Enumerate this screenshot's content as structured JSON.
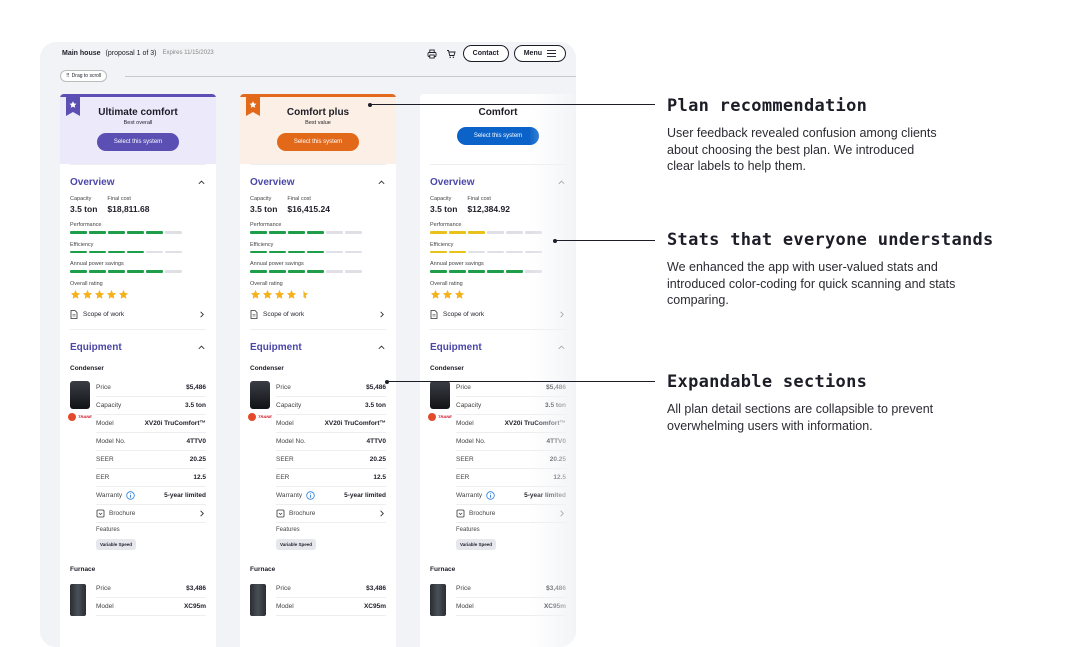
{
  "app": {
    "title": "Main house",
    "subtitle": "(proposal 1 of 3)",
    "expires": "Expires 11/15/2023",
    "contact_label": "Contact",
    "menu_label": "Menu",
    "drag_label": "Drag to scroll"
  },
  "labels": {
    "overview": "Overview",
    "capacity": "Capacity",
    "final_cost": "Final cost",
    "performance": "Performance",
    "efficiency": "Efficiency",
    "annual_savings": "Annual power savings",
    "overall_rating": "Overall rating",
    "scope_of_work": "Scope of work",
    "equipment": "Equipment",
    "condenser": "Condenser",
    "furnace": "Furnace",
    "price": "Price",
    "model": "Model",
    "model_no": "Model No.",
    "seer": "SEER",
    "eer": "EER",
    "warranty": "Warranty",
    "brochure": "Brochure",
    "features": "Features",
    "brand": "TRANE"
  },
  "plans": [
    {
      "name": "Ultimate comfort",
      "tag": "Best overall",
      "select_label": "Select this system",
      "accent": "#5b4fb3",
      "header_bg": "#ece9fb",
      "capacity": "3.5 ton",
      "final_cost": "$18,811.68",
      "performance_fraction": 0.8,
      "efficiency_fraction": 0.6,
      "savings_fraction": 0.8,
      "rating_stars": 5,
      "condenser": {
        "price": "$5,486",
        "capacity": "3.5 ton",
        "model": "XV20i TruComfort™",
        "model_no": "4TTV0",
        "seer": "20.25",
        "eer": "12.5",
        "warranty": "5-year limited",
        "feature": "Variable Speed"
      },
      "furnace": {
        "price": "$3,486",
        "model": "XC95m"
      }
    },
    {
      "name": "Comfort plus",
      "tag": "Best value",
      "select_label": "Select this system",
      "accent": "#e2691a",
      "header_bg": "#fcefe5",
      "capacity": "3.5 ton",
      "final_cost": "$16,415.24",
      "performance_fraction": 0.7,
      "efficiency_fraction": 0.7,
      "savings_fraction": 0.7,
      "rating_stars": 4.5,
      "condenser": {
        "price": "$5,486",
        "capacity": "3.5 ton",
        "model": "XV20i TruComfort™",
        "model_no": "4TTV0",
        "seer": "20.25",
        "eer": "12.5",
        "warranty": "5-year limited",
        "feature": "Variable Speed"
      },
      "furnace": {
        "price": "$3,486",
        "model": "XC95m"
      }
    },
    {
      "name": "Comfort",
      "tag": "",
      "select_label": "Select this system",
      "accent": "#0b63c9",
      "header_bg": "#ffffff",
      "capacity": "3.5 ton",
      "final_cost": "$12,384.92",
      "performance_fraction": 0.5,
      "efficiency_fraction": 0.3,
      "savings_fraction": 0.8,
      "rating_stars": 3,
      "condenser": {
        "price": "$5,486",
        "capacity": "3.5 ton",
        "model": "XV20i TruComfort™",
        "model_no": "4TTV0",
        "seer": "20.25",
        "eer": "12.5",
        "warranty": "5-year limited",
        "feature": "Variable Speed"
      },
      "furnace": {
        "price": "$3,486",
        "model": "XC95m"
      }
    }
  ],
  "callouts": [
    {
      "title": "Plan recommendation",
      "text": "User feedback revealed confusion among clients about choosing the best plan. We introduced clear labels to help them."
    },
    {
      "title": "Stats that everyone understands",
      "text": "We enhanced the app with user-valued stats and introduced color-coding for quick scanning and stats comparing."
    },
    {
      "title": "Expandable sections",
      "text": "All plan detail sections are collapsible to prevent overwhelming users with information."
    }
  ],
  "colors": {
    "section_title": "#4b47a8",
    "bar_green": "#1e9e48",
    "bar_yellow": "#e8c21a",
    "bar_empty": "#dfe0e6",
    "star": "#f5b21b"
  }
}
